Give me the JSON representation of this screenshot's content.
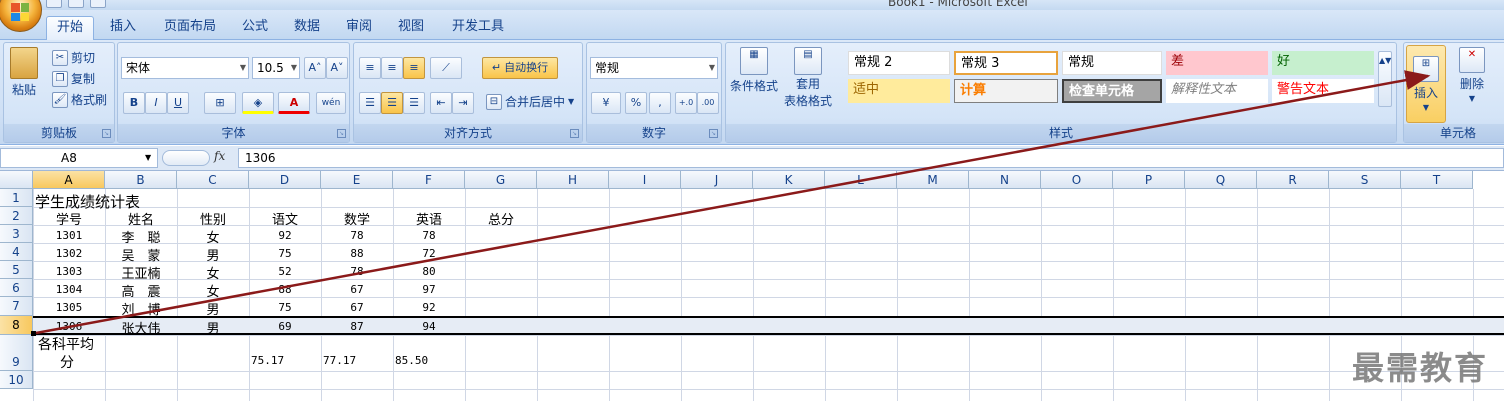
{
  "app": {
    "title": "Book1 - Microsoft Excel"
  },
  "tabs": [
    {
      "label": "开始"
    },
    {
      "label": "插入"
    },
    {
      "label": "页面布局"
    },
    {
      "label": "公式"
    },
    {
      "label": "数据"
    },
    {
      "label": "审阅"
    },
    {
      "label": "视图"
    },
    {
      "label": "开发工具"
    }
  ],
  "clipboard": {
    "paste": "粘贴",
    "cut": "剪切",
    "copy": "复制",
    "format_painter": "格式刷",
    "label": "剪贴板"
  },
  "font": {
    "name": "宋体",
    "size": "10.5",
    "label": "字体",
    "bold": "B",
    "italic": "I",
    "underline": "U",
    "grow": "A˄",
    "shrink": "A˅",
    "phonetic": "wén"
  },
  "alignment": {
    "wrap": "自动换行",
    "merge": "合并后居中",
    "label": "对齐方式"
  },
  "number": {
    "format": "常规",
    "percent": "%",
    "comma": ",",
    "inc": "+.0",
    "dec": ".00",
    "label": "数字"
  },
  "styles": {
    "conditional": "条件格式",
    "table_format_1": "套用",
    "table_format_2": "表格格式",
    "label": "样式",
    "cells": [
      {
        "text": "常规 2"
      },
      {
        "text": "常规 3"
      },
      {
        "text": "常规"
      },
      {
        "text": "差"
      },
      {
        "text": "好"
      },
      {
        "text": "适中"
      },
      {
        "text": "计算"
      },
      {
        "text": "检查单元格"
      },
      {
        "text": "解释性文本"
      },
      {
        "text": "警告文本"
      }
    ]
  },
  "cells_group": {
    "insert": "插入",
    "delete": "删除",
    "label": "单元格"
  },
  "formula_bar": {
    "name_box": "A8",
    "fx": "fx",
    "value": "1306"
  },
  "columns": [
    "A",
    "B",
    "C",
    "D",
    "E",
    "F",
    "G",
    "H",
    "I",
    "J",
    "K",
    "L",
    "M",
    "N",
    "O",
    "P",
    "Q",
    "R",
    "S",
    "T"
  ],
  "rows": [
    "1",
    "2",
    "3",
    "4",
    "5",
    "6",
    "7",
    "8",
    "9",
    "10"
  ],
  "sheet": {
    "title": "学生成绩统计表",
    "headers": [
      "学号",
      "姓名",
      "性别",
      "语文",
      "数学",
      "英语",
      "总分"
    ],
    "records": [
      [
        "1301",
        "李　聪",
        "女",
        "92",
        "78",
        "78"
      ],
      [
        "1302",
        "吴　蒙",
        "男",
        "75",
        "88",
        "72"
      ],
      [
        "1303",
        "王亚楠",
        "女",
        "52",
        "78",
        "80"
      ],
      [
        "1304",
        "高　震",
        "女",
        "88",
        "67",
        "97"
      ],
      [
        "1305",
        "刘　博",
        "男",
        "75",
        "67",
        "92"
      ],
      [
        "1306",
        "张大伟",
        "男",
        "69",
        "87",
        "94"
      ]
    ],
    "avg_label_1": "各科平均",
    "avg_label_2": "分",
    "averages": [
      "75.17",
      "77.17",
      "85.50"
    ]
  },
  "watermark": "最需教育",
  "colors": {
    "accent": "#15428b",
    "arrow": "#8b1a1a",
    "selection": "#f8c85e"
  }
}
